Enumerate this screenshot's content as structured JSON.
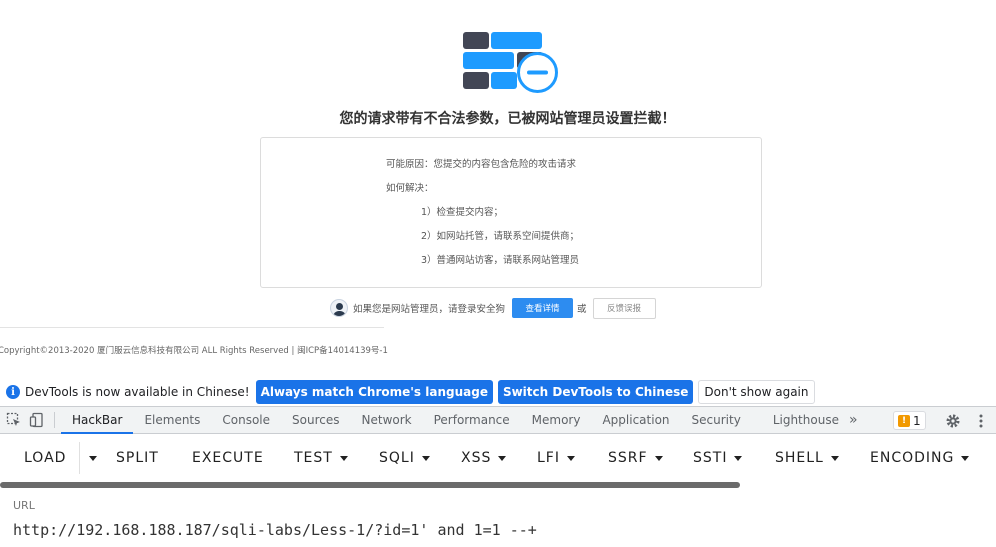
{
  "block_page": {
    "title": "您的请求带有不合法参数，已被网站管理员设置拦截！",
    "reason": "可能原因：您提交的内容包含危险的攻击请求",
    "how_to_fix": "如何解决：",
    "steps": [
      "1）检查提交内容；",
      "2）如网站托管，请联系空间提供商；",
      "3）普通网站访客，请联系网站管理员"
    ],
    "admin_prompt": "如果您是网站管理员，请登录安全狗",
    "detail_button": "查看详情",
    "or_text": "或",
    "report_button": "反馈误报",
    "copyright": "Copyright©2013-2020 厦门服云信息科技有限公司 ALL Rights Reserved | 闽ICP备14014139号-1",
    "colors": {
      "brick_dark": "#424655",
      "brick_blue": "#1e9bff",
      "accent": "#2d8cf0"
    }
  },
  "devtools_infobar": {
    "message": "DevTools is now available in Chinese!",
    "match_button": "Always match Chrome's language",
    "switch_button": "Switch DevTools to Chinese",
    "dismiss_button": "Don't show again"
  },
  "devtools_tabs": {
    "tabs": [
      "HackBar",
      "Elements",
      "Console",
      "Sources",
      "Network",
      "Performance",
      "Memory",
      "Application",
      "Security",
      "Lighthouse"
    ],
    "active": "HackBar",
    "more": "»",
    "issues_count": "1"
  },
  "hackbar": {
    "load": "LOAD",
    "split": "SPLIT",
    "execute": "EXECUTE",
    "menus": [
      "TEST",
      "SQLI",
      "XSS",
      "LFI",
      "SSRF",
      "SSTI",
      "SHELL",
      "ENCODING"
    ],
    "url_label": "URL",
    "url_value": "http://192.168.188.187/sqli-labs/Less-1/?id=1' and 1=1 --+"
  }
}
